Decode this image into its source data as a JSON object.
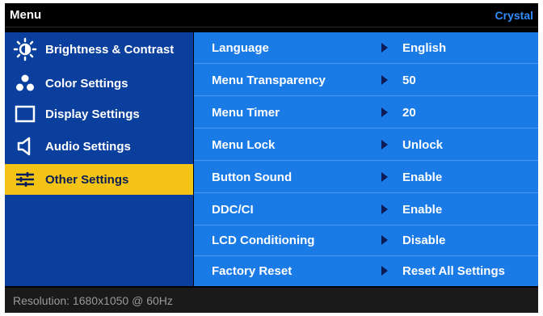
{
  "header": {
    "title": "Menu",
    "brand": "Crystal"
  },
  "left_menu": {
    "items": [
      {
        "label": "Brightness & Contrast",
        "icon": "brightness-icon"
      },
      {
        "label": "Color Settings",
        "icon": "color-settings-icon"
      },
      {
        "label": "Display Settings",
        "icon": "display-icon"
      },
      {
        "label": "Audio Settings",
        "icon": "speaker-icon"
      },
      {
        "label": "Other Settings",
        "icon": "sliders-icon",
        "selected": true
      }
    ]
  },
  "settings": {
    "rows": [
      {
        "label": "Language",
        "value": "English"
      },
      {
        "label": "Menu Transparency",
        "value": "50"
      },
      {
        "label": "Menu Timer",
        "value": "20"
      },
      {
        "label": "Menu Lock",
        "value": "Unlock"
      },
      {
        "label": "Button Sound",
        "value": "Enable"
      },
      {
        "label": "DDC/CI",
        "value": "Enable"
      },
      {
        "label": "LCD Conditioning",
        "value": "Disable"
      },
      {
        "label": "Factory Reset",
        "value": "Reset All Settings"
      }
    ]
  },
  "footer": {
    "resolution": "Resolution: 1680x1050 @ 60Hz"
  },
  "colors": {
    "left_panel": "#0b3f9e",
    "right_panel": "#1a7ae6",
    "selected": "#f3c416",
    "brand": "#2f8cff"
  }
}
